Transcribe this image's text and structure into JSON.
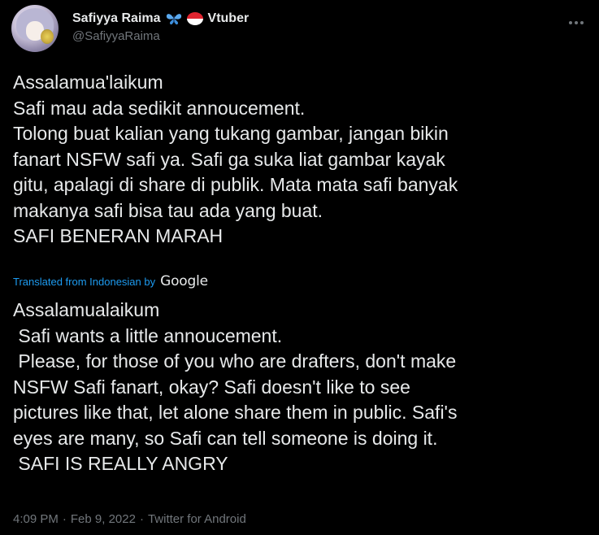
{
  "user": {
    "display_name": "Safiyya Raima",
    "badge_label": "Vtuber",
    "handle": "@SafiyyaRaima",
    "emoji_icons": [
      "butterfly-icon",
      "indonesia-flag-icon"
    ]
  },
  "tweet": {
    "original_lines": [
      "Assalamua'laikum",
      "Safi mau ada sedikit annoucement.",
      "Tolong buat kalian yang tukang gambar, jangan bikin",
      "fanart NSFW safi ya. Safi ga suka liat gambar kayak",
      "gitu, apalagi di share di publik. Mata mata safi banyak",
      "makanya safi bisa tau ada yang buat.",
      "SAFI BENERAN MARAH"
    ],
    "translation_note": "Translated from Indonesian by",
    "translation_provider": "Google",
    "translated_lines": [
      "Assalamualaikum",
      " Safi wants a little annoucement.",
      " Please, for those of you who are drafters, don't make",
      "NSFW Safi fanart, okay? Safi doesn't like to see",
      "pictures like that, let alone share them in public. Safi's",
      "eyes are many, so Safi can tell someone is doing it.",
      " SAFI IS REALLY ANGRY"
    ],
    "time": "4:09 PM",
    "separator": "·",
    "date": "Feb 9, 2022",
    "source": "Twitter for Android"
  },
  "colors": {
    "background": "#000000",
    "text": "#e7e9ea",
    "muted": "#71767b",
    "link": "#1d9bf0"
  }
}
